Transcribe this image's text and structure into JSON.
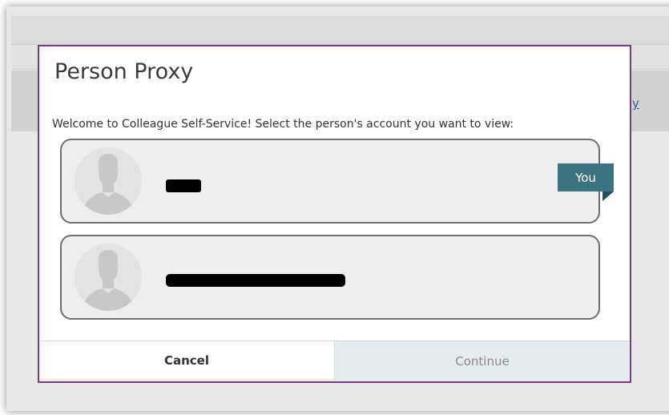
{
  "background": {
    "link_text": "y"
  },
  "modal": {
    "title": "Person Proxy",
    "prompt": "Welcome to Colleague Self-Service! Select the person's account you want to view:",
    "persons": [
      {
        "name": "",
        "redacted": true,
        "badge": "You",
        "avatar": "person-silhouette-icon"
      },
      {
        "name": "",
        "redacted": true,
        "avatar": "person-silhouette-icon"
      }
    ],
    "buttons": {
      "cancel": "Cancel",
      "continue": "Continue"
    }
  },
  "colors": {
    "modal_border": "#7a3b86",
    "badge_bg": "#3b7480",
    "continue_bg": "#e4eeef"
  }
}
